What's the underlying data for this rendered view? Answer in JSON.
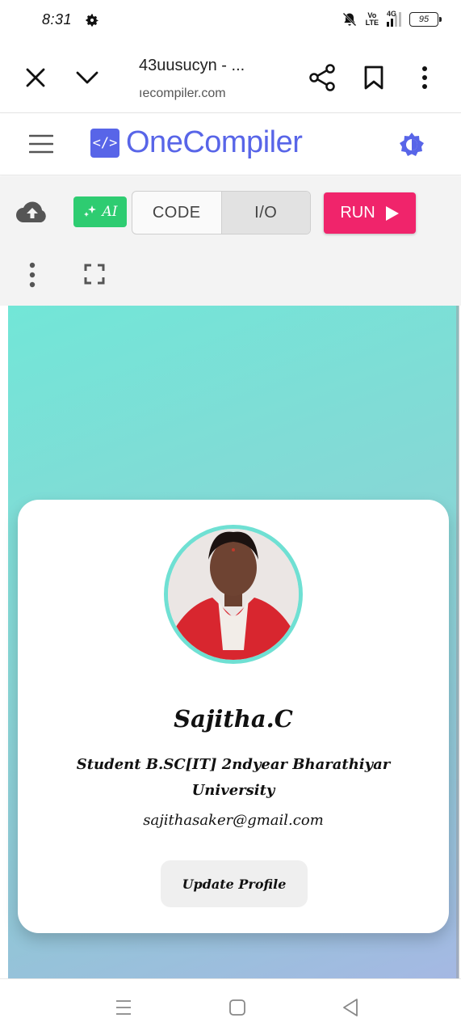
{
  "status_bar": {
    "time": "8:31",
    "network_top": "Vo",
    "network_bottom": "LTE",
    "signal_label": "4G",
    "battery": "95"
  },
  "browser": {
    "page_title": "43uusucyn - ...",
    "url": "ıecompiler.com"
  },
  "app_header": {
    "logo_mark": "</>",
    "logo_text": "OneCompiler",
    "brand_color": "#5865e8"
  },
  "editor_toolbar": {
    "ai_label": "AI",
    "tabs": [
      {
        "label": "CODE",
        "active": false
      },
      {
        "label": "I/O",
        "active": true
      }
    ],
    "run_label": "RUN",
    "run_color": "#f0246b",
    "ai_color": "#2ecc71"
  },
  "profile_card": {
    "name": "Sajitha.C",
    "bio": "Student B.SC[IT] 2ndyear Bharathiyar University",
    "email": "sajithasaker@gmail.com",
    "button_label": "Update Profile",
    "avatar_border_color": "#6fe0d3"
  },
  "icons": {
    "status": [
      "gear-icon",
      "mute-bell-icon",
      "signal-icon",
      "battery-icon"
    ],
    "browser": [
      "close-icon",
      "chevron-down-icon",
      "share-icon",
      "bookmark-icon",
      "more-vertical-icon"
    ],
    "app": [
      "hamburger-icon",
      "theme-toggle-icon",
      "cloud-upload-icon",
      "sparkle-icon",
      "play-icon",
      "kebab-icon",
      "fullscreen-icon"
    ],
    "nav": [
      "recent-apps-icon",
      "home-icon",
      "back-icon"
    ]
  }
}
